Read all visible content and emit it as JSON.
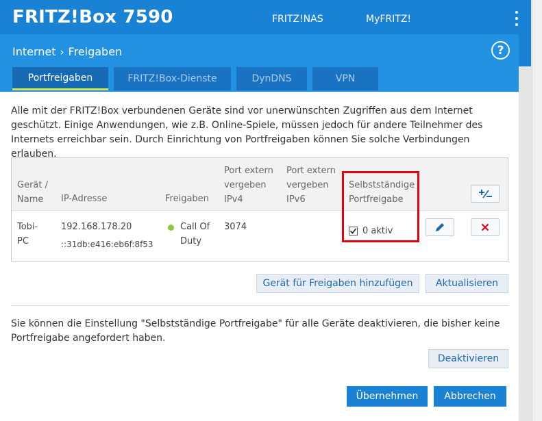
{
  "header": {
    "brand": "FRITZ!Box 7590",
    "nav": [
      "FRITZ!NAS",
      "MyFRITZ!"
    ]
  },
  "breadcrumb": {
    "parent": "Internet",
    "current": "Freigaben"
  },
  "help_label": "?",
  "tabs": [
    {
      "label": "Portfreigaben",
      "active": true
    },
    {
      "label": "FRITZ!Box-Dienste",
      "active": false
    },
    {
      "label": "DynDNS",
      "active": false
    },
    {
      "label": "VPN",
      "active": false
    }
  ],
  "intro_text": "Alle mit der FRITZ!Box verbundenen Geräte sind vor unerwünschten Zugriffen aus dem Internet geschützt. Einige Anwendungen, wie z.B. Online-Spiele, müssen jedoch für andere Teilnehmer des Internets erreichbar sein. Durch Einrichtung von Portfreigaben können Sie solche Verbindungen erlauben.",
  "table": {
    "headers": {
      "device": "Gerät / Name",
      "ip": "IP-Adresse",
      "shares": "Freigaben",
      "port_ipv4": "Port extern vergeben IPv4",
      "port_ipv6": "Port extern vergeben IPv6",
      "self_share": "Selbstständige Portfreigabe"
    },
    "rows": [
      {
        "device": "Tobi-PC",
        "ipv4": "192.168.178.20",
        "ipv6": "::31db:e416:eb6f:8f53",
        "share": "Call Of Duty",
        "port_ipv4": "3074",
        "port_ipv6": "",
        "self_share_checked": true,
        "self_share_label": "0 aktiv"
      }
    ]
  },
  "buttons": {
    "add_device": "Gerät für Freigaben hinzufügen",
    "refresh": "Aktualisieren",
    "deactivate": "Deaktivieren",
    "apply": "Übernehmen",
    "cancel": "Abbrechen"
  },
  "note_text": "Sie können die Einstellung \"Selbstständige Portfreigabe\" für alle Geräte deaktivieren, die bisher keine Portfreigabe angefordert haben.",
  "colors": {
    "header_blue": "#1a82d4",
    "highlight_red": "#e3000f",
    "status_green": "#8dc63f"
  }
}
